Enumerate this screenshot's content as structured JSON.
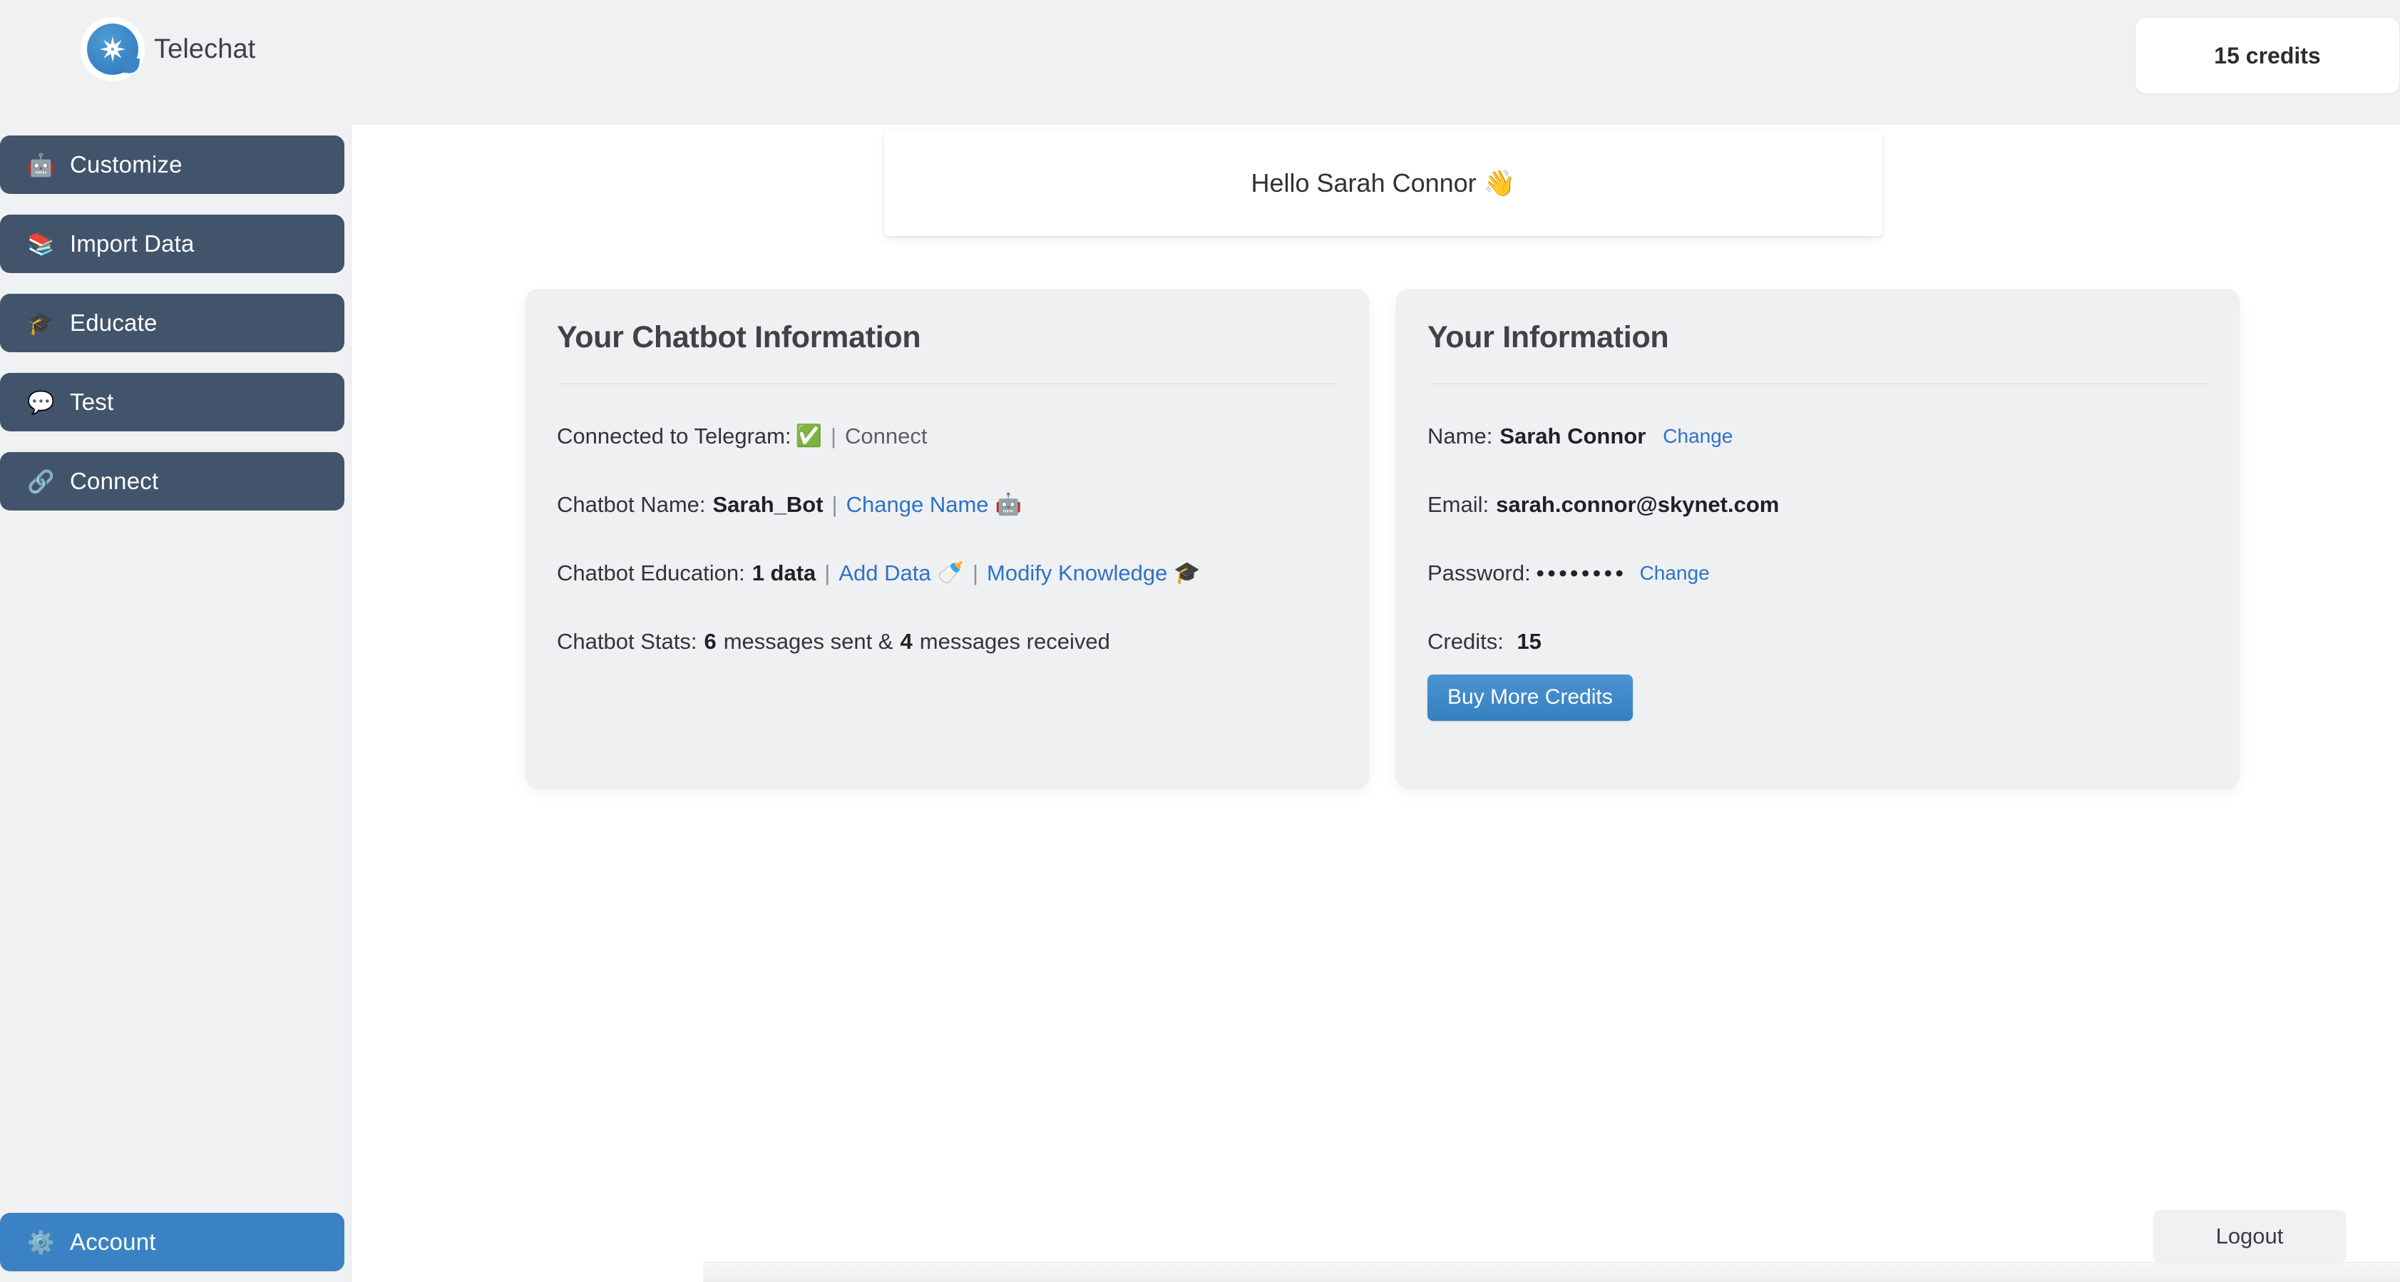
{
  "brand": {
    "name": "Telechat",
    "logo_icon": "telechat-snowflake-bubble-logo"
  },
  "header": {
    "credits_badge": "15 credits"
  },
  "sidebar": {
    "items": [
      {
        "emoji": "🤖",
        "icon": "robot-icon",
        "label": "Customize"
      },
      {
        "emoji": "📚",
        "icon": "books-icon",
        "label": "Import Data"
      },
      {
        "emoji": "🎓",
        "icon": "graduation-cap-icon",
        "label": "Educate"
      },
      {
        "emoji": "💬",
        "icon": "speech-balloon-icon",
        "label": "Test"
      },
      {
        "emoji": "🔗",
        "icon": "link-icon",
        "label": "Connect"
      }
    ],
    "account": {
      "emoji": "⚙️",
      "icon": "gear-icon",
      "label": "Account"
    }
  },
  "main": {
    "greeting": "Hello Sarah Connor 👋",
    "chatbot_card": {
      "title": "Your Chatbot Information",
      "telegram": {
        "label": "Connected to Telegram:",
        "status_emoji": "✅",
        "separator": "|",
        "connect_link": "Connect"
      },
      "name": {
        "label": "Chatbot Name:",
        "value": "Sarah_Bot",
        "separator": "|",
        "change_link": "Change Name",
        "change_emoji": "🤖"
      },
      "education": {
        "label": "Chatbot Education:",
        "value": "1 data",
        "separator": "|",
        "add_link": "Add Data",
        "add_emoji": "🍼",
        "separator2": "|",
        "modify_link": "Modify Knowledge",
        "modify_emoji": "🎓"
      },
      "stats": {
        "label": "Chatbot Stats:",
        "sent_value": "6",
        "sent_text": "messages sent &",
        "received_value": "4",
        "received_text": "messages received"
      }
    },
    "user_card": {
      "title": "Your Information",
      "name": {
        "label": "Name:",
        "value": "Sarah Connor",
        "change_link": "Change"
      },
      "email": {
        "label": "Email:",
        "value": "sarah.connor@skynet.com"
      },
      "password": {
        "label": "Password:",
        "masked": "••••••••",
        "change_link": "Change"
      },
      "credits": {
        "label": "Credits:",
        "value": "15"
      },
      "buy_button": "Buy More Credits"
    }
  },
  "footer": {
    "logout": "Logout"
  },
  "colors": {
    "sidebar_item": "#41546b",
    "accent_blue": "#3a82c4",
    "link_blue": "#2f72c4",
    "page_bg": "#eff1f3",
    "card_bg": "#eff0f2",
    "main_bg": "#ffffff"
  }
}
